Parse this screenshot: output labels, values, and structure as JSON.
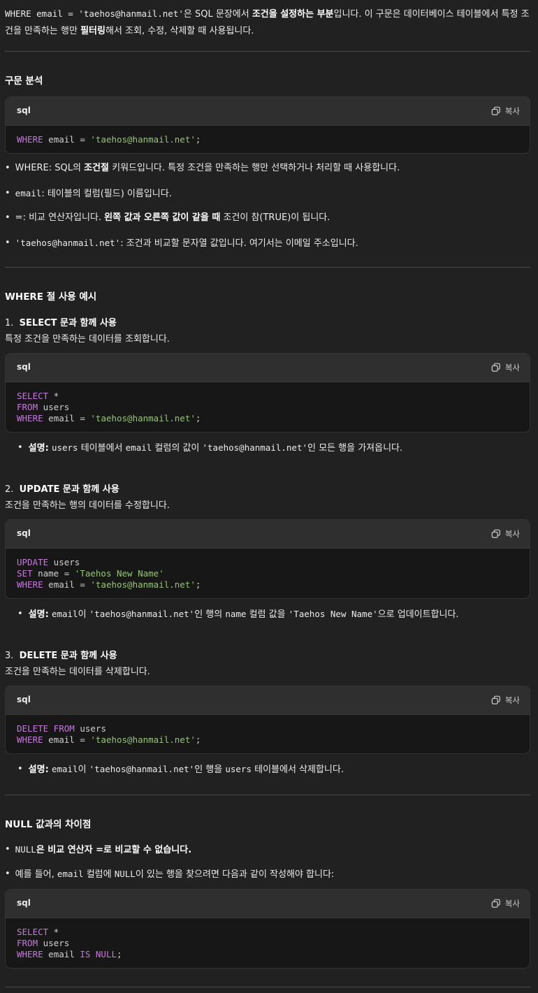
{
  "intro": {
    "code": "WHERE email = 'taehos@hanmail.net'",
    "t1": "은 SQL 문장에서 ",
    "b1": "조건을 설정하는 부분",
    "t2": "입니다. 이 구문은 데이터베이스 테이블에서 특정 조건을 만족하는 행만 ",
    "b2": "필터링",
    "t3": "해서 조회, 수정, 삭제할 때 사용됩니다."
  },
  "copy_label": "복사",
  "lang": "sql",
  "sec1": {
    "title": "구문 분석",
    "code": {
      "kw1": "WHERE",
      "mid": " email = ",
      "str": "'taehos@hanmail.net'",
      "end": ";"
    },
    "bullets": [
      {
        "pre": "WHERE: SQL의 ",
        "b": "조건절",
        "post": " 키워드입니다. 특정 조건을 만족하는 행만 선택하거나 처리할 때 사용합니다."
      },
      {
        "code": "email",
        "post": ": 테이블의 컬럼(필드) 이름입니다."
      },
      {
        "pre": "=: 비교 연산자입니다. ",
        "b": "왼쪽 값과 오른쪽 값이 같을 때",
        "post": " 조건이 참(TRUE)이 됩니다."
      },
      {
        "code": "'taehos@hanmail.net'",
        "post": ": 조건과 비교할 문자열 값입니다. 여기서는 이메일 주소입니다."
      }
    ]
  },
  "sec2": {
    "title": "WHERE 절 사용 예시",
    "ex1": {
      "num": "1.",
      "title": "SELECT 문과 함께 사용",
      "desc": "특정 조건을 만족하는 데이터를 조회합니다.",
      "explain_label": "설명",
      "explain_code1": "users",
      "explain_t1": " 테이블에서 ",
      "explain_code2": "email",
      "explain_t2": " 컬럼의 값이 ",
      "explain_code3": "'taehos@hanmail.net'",
      "explain_t3": "인 모든 행을 가져옵니다."
    },
    "ex2": {
      "num": "2.",
      "title": "UPDATE 문과 함께 사용",
      "desc": "조건을 만족하는 행의 데이터를 수정합니다.",
      "explain_label": "설명",
      "explain_code1": "email",
      "explain_t1": "이 ",
      "explain_code2": "'taehos@hanmail.net'",
      "explain_t2": "인 행의 ",
      "explain_code3": "name",
      "explain_t3": " 컬럼 값을 ",
      "explain_code4": "'Taehos New Name'",
      "explain_t4": "으로 업데이트합니다."
    },
    "ex3": {
      "num": "3.",
      "title": "DELETE 문과 함께 사용",
      "desc": "조건을 만족하는 데이터를 삭제합니다.",
      "explain_label": "설명",
      "explain_code1": "email",
      "explain_t1": "이 ",
      "explain_code2": "'taehos@hanmail.net'",
      "explain_t2": "인 행을 ",
      "explain_code3": "users",
      "explain_t3": " 테이블에서 삭제합니다."
    }
  },
  "sec3": {
    "title": "NULL 값과의 차이점",
    "b1_code": "NULL",
    "b1_text": "은 비교 연산자 =로 비교할 수 없습니다.",
    "b2_t1": "예를 들어, ",
    "b2_code": "email",
    "b2_t2": " 컬럼에 ",
    "b2_code2": "NULL",
    "b2_t3": "이 있는 행을 찾으려면 다음과 같이 작성해야 합니다:"
  }
}
